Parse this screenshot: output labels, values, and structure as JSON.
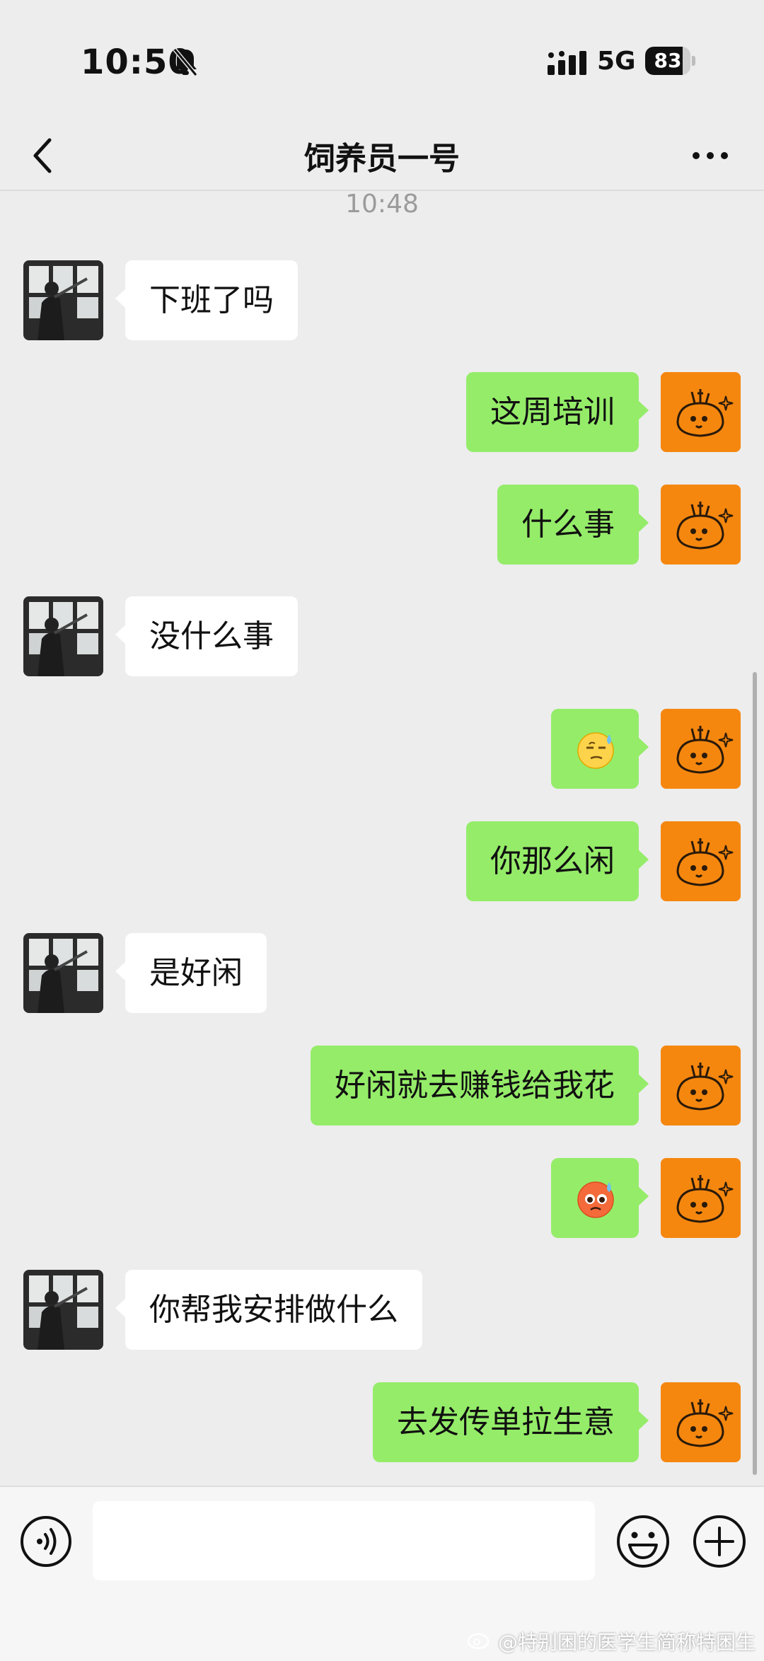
{
  "status_bar": {
    "time": "10:50",
    "network": "5G",
    "battery": "83",
    "battery_level": 0.83
  },
  "header": {
    "title": "饲养员一号"
  },
  "chat": {
    "timestamp": "10:48",
    "messages": [
      {
        "side": "in",
        "text": "下班了吗"
      },
      {
        "side": "out",
        "text": "这周培训"
      },
      {
        "side": "out",
        "text": "什么事"
      },
      {
        "side": "in",
        "text": "没什么事"
      },
      {
        "side": "out",
        "emoji": "sweat-smile-emoji"
      },
      {
        "side": "out",
        "text": "你那么闲"
      },
      {
        "side": "in",
        "text": "是好闲"
      },
      {
        "side": "out",
        "text": "好闲就去赚钱给我花"
      },
      {
        "side": "out",
        "emoji": "pleading-emoji"
      },
      {
        "side": "in",
        "text": "你帮我安排做什么"
      },
      {
        "side": "out",
        "text": "去发传单拉生意"
      }
    ]
  },
  "input_bar": {
    "placeholder": ""
  },
  "watermark": "@特别困的医学生简称特困生",
  "colors": {
    "background": "#ededed",
    "outgoing_bubble": "#95ec69",
    "incoming_bubble": "#ffffff",
    "my_avatar": "#f5870f"
  }
}
